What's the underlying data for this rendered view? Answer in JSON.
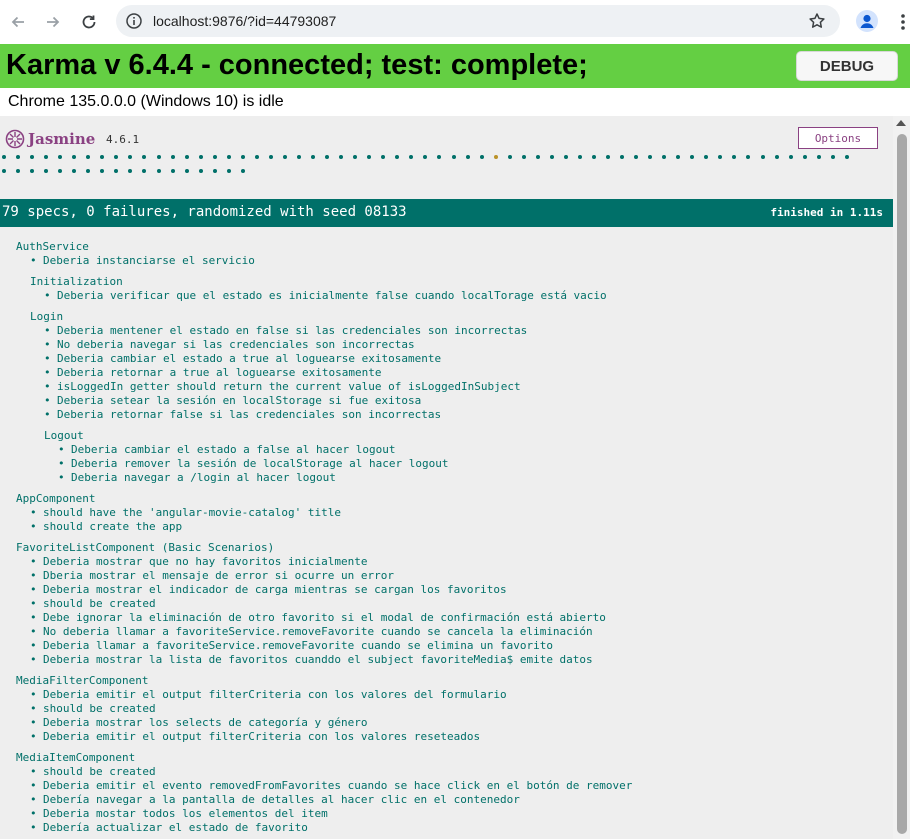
{
  "browser": {
    "url": "localhost:9876/?id=44793087"
  },
  "karma": {
    "banner_title": "Karma v 6.4.4 - connected; test: complete;",
    "debug_label": "DEBUG",
    "browser_status": "Chrome 135.0.0.0 (Windows 10) is idle"
  },
  "jasmine": {
    "logo_text": "Jasmine",
    "version": "4.6.1",
    "options_label": "Options",
    "summary": "79 specs, 0 failures, randomized with seed 08133",
    "finished": "finished in 1.11s",
    "spec_dots": {
      "total": 79,
      "pending_index": 35
    },
    "colors": {
      "passed": "#007069",
      "pending": "#ba9229",
      "brand": "#8a4182",
      "banner": "#64cf43"
    }
  },
  "suites": [
    {
      "title": "AuthService",
      "specs": [
        "Deberia instanciarse el servicio"
      ]
    },
    {
      "title": "Initialization",
      "specs": [
        "Deberia verificar que el estado es inicialmente false cuando localTorage está vacio"
      ]
    },
    {
      "title": "Login",
      "specs": [
        "Deberia mentener el estado en false si las credenciales son incorrectas",
        "No deberia navegar si las credenciales son incorrectas",
        "Deberia cambiar el estado a true al loguearse exitosamente",
        "Deberia retornar a true al loguearse exitosamente",
        "isLoggedIn getter should return the current value of isLoggedInSubject",
        "Deberia setear la sesión en localStorage si fue exitosa",
        "Deberia retornar false si las credenciales son incorrectas"
      ]
    },
    {
      "title": "Logout",
      "specs": [
        "Deberia cambiar el estado a false al hacer logout",
        "Deberia remover la sesión de localStorage al hacer logout",
        "Deberia navegar a /login al hacer logout"
      ]
    },
    {
      "title": "AppComponent",
      "specs": [
        "should have the 'angular-movie-catalog' title",
        "should create the app"
      ]
    },
    {
      "title": "FavoriteListComponent (Basic Scenarios)",
      "specs": [
        "Deberia mostrar que no hay favoritos inicialmente",
        "Dberia mostrar el mensaje de error si ocurre un error",
        "Deberia mostrar el indicador de carga mientras se cargan los favoritos",
        "should be created",
        "Debe ignorar la eliminación de otro favorito si el modal de confirmación está abierto",
        "No deberia llamar a favoriteService.removeFavorite cuando se cancela la eliminación",
        "Deberia llamar a favoriteService.removeFavorite cuando se elimina un favorito",
        "Deberia mostrar la lista de favoritos cuanddo el subject favoriteMedia$ emite datos"
      ]
    },
    {
      "title": "MediaFilterComponent",
      "specs": [
        "Deberia emitir el output filterCriteria con los valores del formulario",
        "should be created",
        "Deberia mostrar los selects de categoría y género",
        "Deberia emitir el output filterCriteria con los valores reseteados"
      ]
    },
    {
      "title": "MediaItemComponent",
      "specs": [
        "should be created",
        "Deberia emitir el evento removedFromFavorites cuando se hace click en el botón de remover",
        "Debería navegar a la pantalla de detalles al hacer clic en el contenedor",
        "Deberia mostar todos los elementos del item",
        "Debería actualizar el estado de favorito"
      ]
    }
  ]
}
